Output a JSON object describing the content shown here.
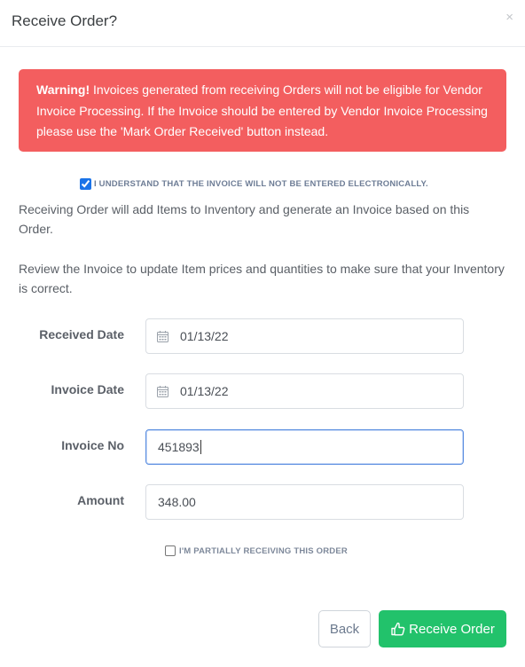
{
  "modal": {
    "title": "Receive Order?",
    "close_glyph": "×"
  },
  "alert": {
    "lead": "Warning!",
    "text": " Invoices generated from receiving Orders will not be eligible for Vendor Invoice Processing. If the Invoice should be entered by Vendor Invoice Processing please use the 'Mark Order Received' button instead.",
    "color": "#f35e5f"
  },
  "understand": {
    "checked": true,
    "label": "I understand that the invoice will not be entered electronically."
  },
  "paragraphs": {
    "p1": "Receiving Order will add Items to Inventory and generate an Invoice based on this Order.",
    "p2": "Review the Invoice to update Item prices and quantities to make sure that your Inventory is correct."
  },
  "form": {
    "received_date": {
      "label": "Received Date",
      "value": "01/13/22",
      "icon": "calendar-icon"
    },
    "invoice_date": {
      "label": "Invoice Date",
      "value": "01/13/22",
      "icon": "calendar-icon"
    },
    "invoice_no": {
      "label": "Invoice No",
      "value": "451893"
    },
    "amount": {
      "label": "Amount",
      "value": "348.00"
    }
  },
  "partial": {
    "checked": false,
    "label": "I'm partially receiving this order"
  },
  "buttons": {
    "back": "Back",
    "receive": "Receive Order",
    "receive_icon": "hand-thumbs-up-icon",
    "receive_color": "#22c26b"
  }
}
